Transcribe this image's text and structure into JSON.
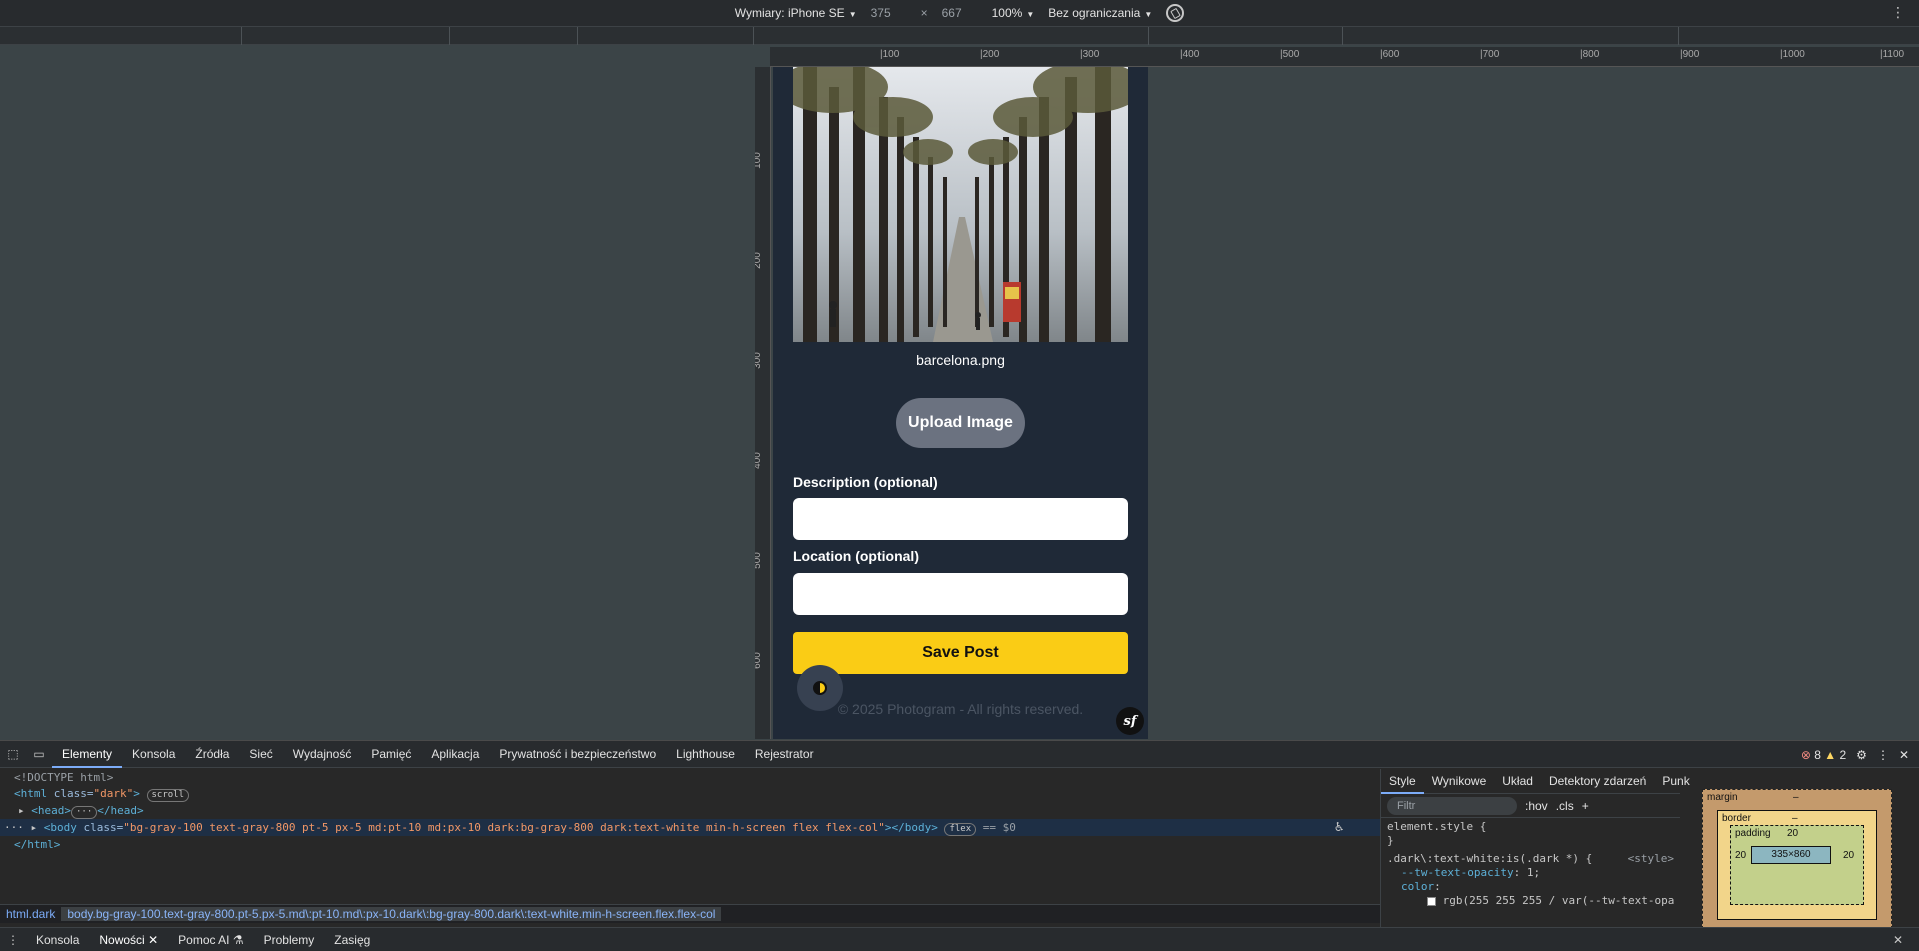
{
  "device_toolbar": {
    "dimensions_label": "Wymiary: iPhone SE",
    "width": "375",
    "times": "×",
    "height": "667",
    "zoom": "100%",
    "throttling": "Bez ograniczania"
  },
  "rulers": {
    "h_ticks": [
      "100",
      "200",
      "300",
      "400",
      "500",
      "600",
      "700",
      "800",
      "900",
      "1000",
      "1100"
    ],
    "v_ticks": [
      "100",
      "200",
      "300",
      "400",
      "500",
      "600"
    ]
  },
  "app": {
    "filename": "barcelona.png",
    "upload_label": "Upload Image",
    "description_label": "Description (optional)",
    "description_value": "",
    "location_label": "Location (optional)",
    "location_value": "",
    "save_label": "Save Post",
    "footer": "© 2025 Photogram - All rights reserved.",
    "sf_badge": "sf"
  },
  "devtools": {
    "tabs": [
      "Elementy",
      "Konsola",
      "Źródła",
      "Sieć",
      "Wydajność",
      "Pamięć",
      "Aplikacja",
      "Prywatność i bezpieczeństwo",
      "Lighthouse",
      "Rejestrator"
    ],
    "active_tab": "Elementy",
    "error_count": "8",
    "warning_count": "2",
    "code": {
      "doctype": "<!DOCTYPE html>",
      "html_open": "<html",
      "html_attr": "class=",
      "html_class": "\"dark\"",
      "html_close": ">",
      "scroll_pill": "scroll",
      "head_open": "<head>",
      "head_close": "</head>",
      "body_open": "<body",
      "body_attr": "class=",
      "body_class": "\"bg-gray-100 text-gray-800 pt-5 px-5 md:pt-10 md:px-10 dark:bg-gray-800 dark:text-white min-h-screen flex flex-col\"",
      "body_tail": "></body>",
      "flex_pill": "flex",
      "selected_ref": "== $0",
      "html_end": "</html>"
    },
    "breadcrumb": [
      "html.dark",
      "body.bg-gray-100.text-gray-800.pt-5.px-5.md\\:pt-10.md\\:px-10.dark\\:bg-gray-800.dark\\:text-white.min-h-screen.flex.flex-col"
    ],
    "styles": {
      "tabs": [
        "Style",
        "Wynikowe",
        "Układ",
        "Detektory zdarzeń",
        "Punkty przerwania DOM"
      ],
      "active": "Style",
      "filter_placeholder": "Filtr",
      "hov": ":hov",
      "cls": ".cls",
      "element_style": "element.style {",
      "close_brace": "}",
      "selector": ".dark\\:text-white:is(.dark *) {",
      "source": "<style>",
      "prop1_name": "--tw-text-opacity",
      "prop1_val": ": 1;",
      "prop2_name": "color",
      "prop2_val": ":",
      "prop2_value": "rgb(255 255 255 / var(--tw-text-opa"
    },
    "box_model": {
      "margin_label": "margin",
      "margin_value": "–",
      "border_label": "border",
      "border_value": "–",
      "padding_label": "padding",
      "padding_value": "20",
      "padding_left": "20",
      "padding_right": "20",
      "content": "335×860",
      "side_dash": "–"
    },
    "drawer_tabs": [
      "Konsola",
      "Nowości",
      "Pomoc AI",
      "Problemy",
      "Zasięg"
    ],
    "drawer_active": "Nowości"
  }
}
